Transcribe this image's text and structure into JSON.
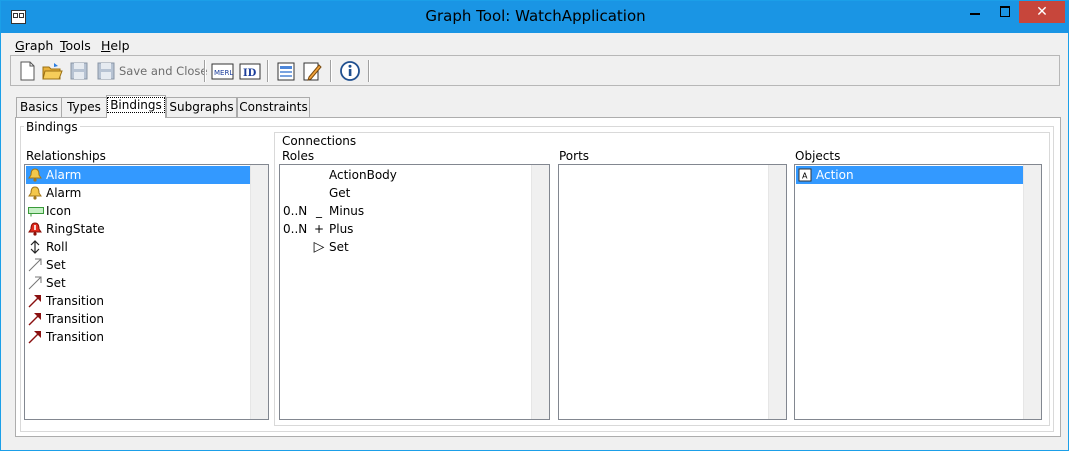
{
  "window": {
    "title": "Graph Tool: WatchApplication",
    "close_glyph": "✕"
  },
  "menu": [
    {
      "label_u": "G",
      "label_rest": "raph"
    },
    {
      "label_u": "T",
      "label_rest": "ools"
    },
    {
      "label_u": "H",
      "label_rest": "elp"
    }
  ],
  "toolbar": {
    "save_close_label": "Save and Close",
    "icons": [
      "new-document-icon",
      "open-folder-icon",
      "save-icon",
      "save-close-icon",
      "merl-icon",
      "id-icon",
      "properties-icon",
      "edit-icon",
      "info-icon"
    ]
  },
  "tabs": [
    "Basics",
    "Types",
    "Bindings",
    "Subgraphs",
    "Constraints"
  ],
  "active_tab": "Bindings",
  "bindings": {
    "group_label": "Bindings",
    "relationships_label": "Relationships",
    "relationships": [
      {
        "label": "Alarm",
        "icon": "bell-icon",
        "selected": true
      },
      {
        "label": "Alarm",
        "icon": "bell-icon",
        "selected": false
      },
      {
        "label": "Icon",
        "icon": "green-rect-icon",
        "selected": false
      },
      {
        "label": "RingState",
        "icon": "red-warning-icon",
        "selected": false
      },
      {
        "label": "Roll",
        "icon": "double-arrow-icon",
        "selected": false
      },
      {
        "label": "Set",
        "icon": "arrow-diagonal-icon",
        "selected": false
      },
      {
        "label": "Set",
        "icon": "arrow-diagonal-icon",
        "selected": false
      },
      {
        "label": "Transition",
        "icon": "red-arrow-icon",
        "selected": false
      },
      {
        "label": "Transition",
        "icon": "red-arrow-icon",
        "selected": false
      },
      {
        "label": "Transition",
        "icon": "red-arrow-icon",
        "selected": false
      }
    ],
    "connections_label": "Connections",
    "roles_label": "Roles",
    "roles": [
      {
        "card": "",
        "sym": "",
        "label": "ActionBody",
        "selected": true
      },
      {
        "card": "",
        "sym": "",
        "label": "Get",
        "selected": false
      },
      {
        "card": "0..N",
        "sym": "_",
        "label": "Minus",
        "selected": false
      },
      {
        "card": "0..N",
        "sym": "+",
        "label": "Plus",
        "selected": false
      },
      {
        "card": "",
        "sym": "▷",
        "label": "Set",
        "selected": false
      }
    ],
    "ports_label": "Ports",
    "objects_label": "Objects",
    "objects": [
      {
        "label": "Action",
        "icon": "object-a-icon",
        "selected": true
      }
    ]
  },
  "colors": {
    "selection": "#3399ff",
    "titlebar": "#1a95e4",
    "close": "#c7463b"
  }
}
